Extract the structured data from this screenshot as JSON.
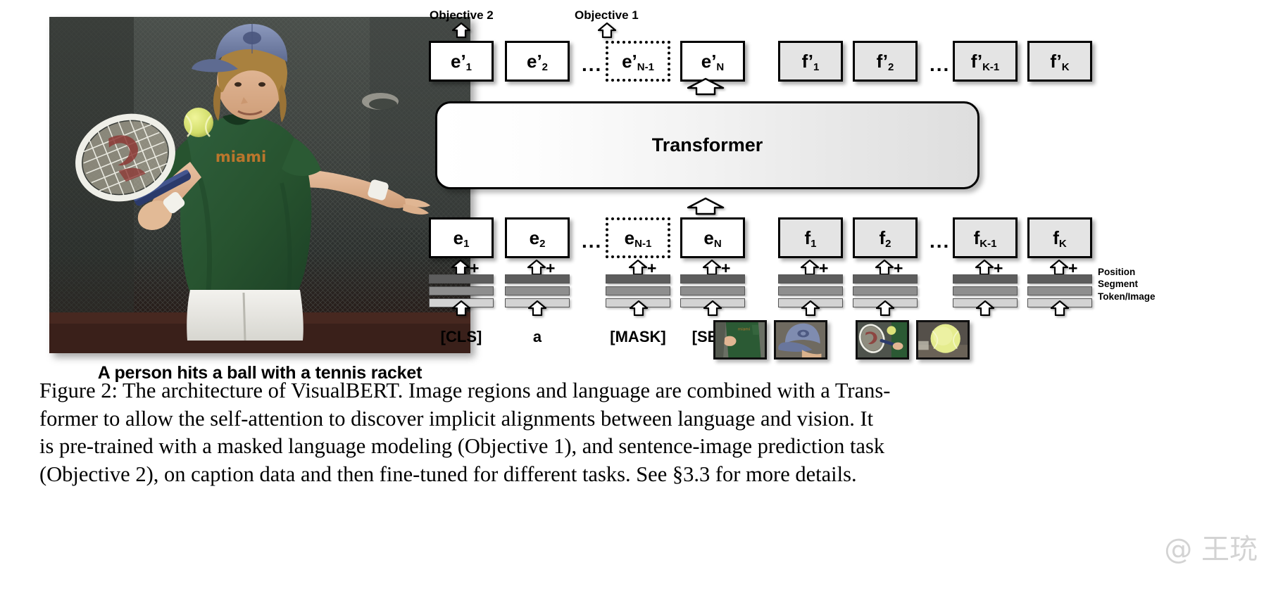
{
  "photo": {
    "alt_name": "tennis-player-photo",
    "caption": "A person hits a ball with a tennis racket"
  },
  "diagram": {
    "objective_2_label": "Objective 2",
    "objective_1_label": "Objective 1",
    "transformer_label": "Transformer",
    "ellipsis": "...",
    "plus": "+",
    "output_tokens": [
      {
        "base": "e'",
        "sub": "1",
        "style": "white"
      },
      {
        "base": "e'",
        "sub": "2",
        "style": "white"
      },
      {
        "base": "e'",
        "sub": "N-1",
        "style": "dotted"
      },
      {
        "base": "e'",
        "sub": "N",
        "style": "white"
      },
      {
        "base": "f'",
        "sub": "1",
        "style": "gray"
      },
      {
        "base": "f'",
        "sub": "2",
        "style": "gray"
      },
      {
        "base": "f'",
        "sub": "K-1",
        "style": "gray"
      },
      {
        "base": "f'",
        "sub": "K",
        "style": "gray"
      }
    ],
    "input_tokens": [
      {
        "base": "e",
        "sub": "1",
        "style": "white"
      },
      {
        "base": "e",
        "sub": "2",
        "style": "white"
      },
      {
        "base": "e",
        "sub": "N-1",
        "style": "dotted"
      },
      {
        "base": "e",
        "sub": "N",
        "style": "white"
      },
      {
        "base": "f",
        "sub": "1",
        "style": "gray"
      },
      {
        "base": "f",
        "sub": "2",
        "style": "gray"
      },
      {
        "base": "f",
        "sub": "K-1",
        "style": "gray"
      },
      {
        "base": "f",
        "sub": "K",
        "style": "gray"
      }
    ],
    "embedding_legend": [
      {
        "name": "Position",
        "color": "#5d5d5d"
      },
      {
        "name": "Segment",
        "color": "#8e8e8e"
      },
      {
        "name": "Token/Image",
        "color": "#d3d3d3"
      }
    ],
    "bottom_text_tokens": [
      "[CLS]",
      "a",
      "[MASK]",
      "[SEP]"
    ],
    "bottom_image_regions": [
      "region-torso-shirt",
      "region-blue-cap",
      "region-racket-and-ball",
      "region-tennis-ball"
    ]
  },
  "figure_caption": {
    "line1": "Figure 2: The architecture of VisualBERT. Image regions and language are combined with a Trans-",
    "line2": "former to allow the self-attention to discover implicit alignments between language and vision. It",
    "line3": "is pre-trained with a masked language modeling (Objective 1), and sentence-image prediction task",
    "line4": "(Objective 2), on caption data and then fine-tuned for different tasks. See §3.3 for more details."
  },
  "watermark": "@ 王珫"
}
